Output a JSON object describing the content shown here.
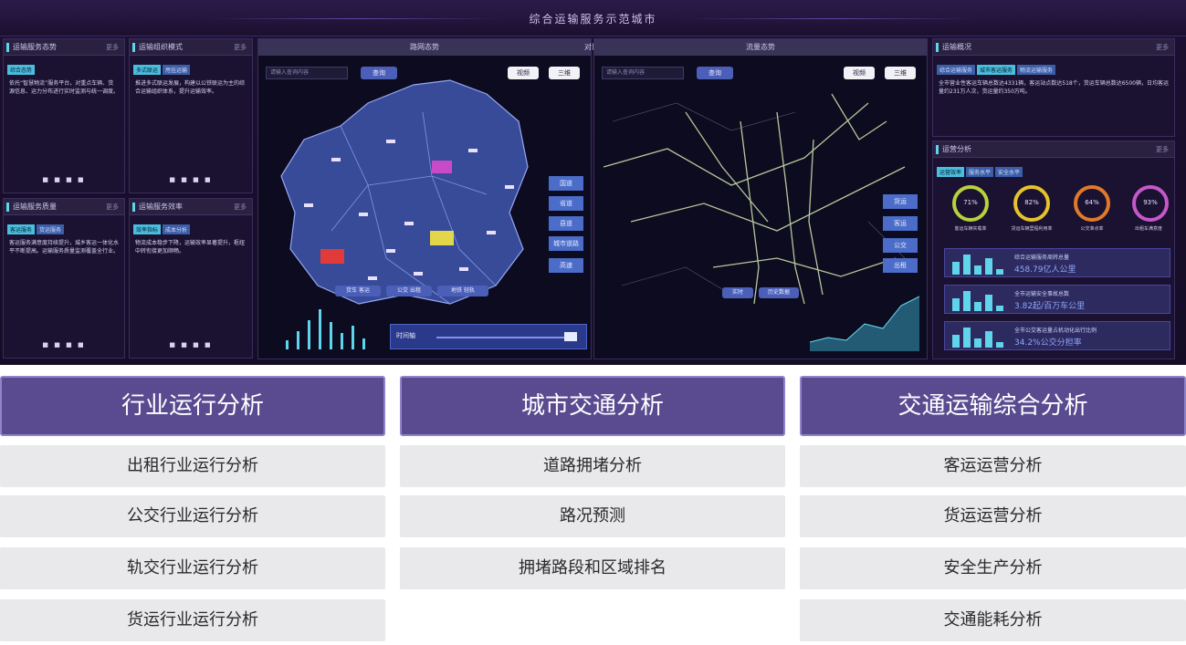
{
  "dashboard": {
    "title": "综合运输服务示范城市",
    "panels": [
      {
        "title": "运输服务态势",
        "more": "更多",
        "tags": [
          "综合态势"
        ],
        "text": "依托“智慧物流”服务平台，对重点车辆、货源信息、运力分布进行实时监测与统一调度。"
      },
      {
        "title": "运输组织模式",
        "more": "更多",
        "tags": [
          "多式联运",
          "甩挂运输"
        ],
        "text": "推进多式联运发展，构建以公铁联运为主的综合运输组织体系，提升运输效率。"
      },
      {
        "title": "运输服务质量",
        "more": "更多",
        "tags": [
          "客运服务",
          "货运服务"
        ],
        "text": "客运服务满意度持续提升，城乡客运一体化水平不断提高。运输服务质量监测覆盖全行业。"
      },
      {
        "title": "运输服务效率",
        "more": "更多",
        "tags": [
          "效率指标",
          "成本分析"
        ],
        "text": "物流成本稳步下降，运输效率显著提升，枢纽中转衔接更加顺畅。"
      }
    ],
    "dots": "■ ■ ■ ■",
    "left_map": {
      "title": "路网态势",
      "search_placeholder": "请输入查询内容",
      "search_button": "查询",
      "toggle_a": "视频",
      "toggle_b": "三维",
      "side_buttons": [
        "国道",
        "省道",
        "县道",
        "城市道路",
        "高速"
      ],
      "bottom_tabs": [
        "货车 客运",
        "公交 出租",
        "地铁 轻轨"
      ],
      "timeline_label": "时间轴"
    },
    "center_label": "对比",
    "right_map": {
      "title": "流量态势",
      "search_placeholder": "请输入查询内容",
      "search_button": "查询",
      "toggle_a": "视频",
      "toggle_b": "三维",
      "side_buttons": [
        "货运",
        "客运",
        "公交",
        "出租"
      ],
      "bottom_tabs": [
        "实时",
        "历史数据"
      ]
    },
    "right_top": {
      "title": "运输概况",
      "more": "更多",
      "tags": [
        "综合运输服务",
        "城市客运服务",
        "物流运输服务"
      ],
      "text": "全市营业性客运车辆总数达4331辆，客运站点数达518个，货运车辆总数达6500辆，日均客运量约231万人次，货运量约350万吨。"
    },
    "right_gauges": {
      "title": "运营分析",
      "more": "更多",
      "tags": [
        "运营效率",
        "服务水平",
        "安全水平"
      ],
      "gauges": [
        {
          "value": "71%",
          "label": "客运车辆实载率",
          "color": "#b7d23b"
        },
        {
          "value": "82%",
          "label": "货运车辆里程利用率",
          "color": "#e6c32a"
        },
        {
          "value": "64%",
          "label": "公交准点率",
          "color": "#e07a2a"
        },
        {
          "value": "93%",
          "label": "出租车满意度",
          "color": "#c558c8"
        }
      ]
    },
    "kpis": [
      {
        "label": "综合运输服务周转总量",
        "value": "458.79亿人公里"
      },
      {
        "label": "全市运输安全事故总数",
        "value": "3.82起/百万车公里"
      },
      {
        "label": "全市公交客运量占机动化出行比例",
        "value": "34.2%公交分担率"
      }
    ]
  },
  "categories": [
    {
      "title": "行业运行分析",
      "items": [
        "出租行业运行分析",
        "公交行业运行分析",
        "轨交行业运行分析",
        "货运行业运行分析"
      ]
    },
    {
      "title": "城市交通分析",
      "items": [
        "道路拥堵分析",
        "路况预测",
        "拥堵路段和区域排名"
      ]
    },
    {
      "title": "交通运输综合分析",
      "items": [
        "客运运营分析",
        "货运运营分析",
        "安全生产分析",
        "交通能耗分析"
      ]
    }
  ],
  "colors": {
    "category_header": "#5a4b91",
    "category_item": "#e9e8ea",
    "dashboard_bg": "#1c1030"
  }
}
